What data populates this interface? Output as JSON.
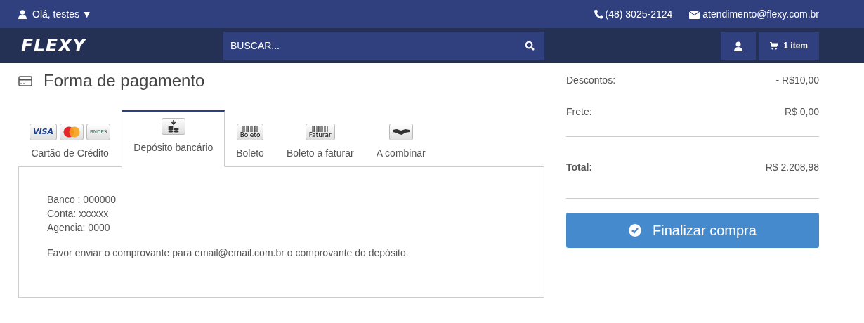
{
  "top_bar": {
    "greeting": "Olá, testes",
    "caret": "▼",
    "phone": "(48) 3025-2124",
    "email": "atendimento@flexy.com.br"
  },
  "header": {
    "logo": "FLEXY",
    "search": {
      "placeholder": "BUSCAR..."
    },
    "cart": "1 item"
  },
  "payment": {
    "title": "Forma de pagamento",
    "tabs": [
      {
        "label": "Cartão de Crédito",
        "kind": "cards",
        "badges": [
          "VISA",
          "BNDES"
        ],
        "selected": false
      },
      {
        "label": "Depósito bancário",
        "kind": "deposit",
        "selected": true
      },
      {
        "label": "Boleto",
        "kind": "barcode",
        "badges": [
          "Boleto"
        ],
        "selected": false
      },
      {
        "label": "Boleto a faturar",
        "kind": "barcode",
        "badges": [
          "Faturar"
        ],
        "selected": false
      },
      {
        "label": "A combinar",
        "kind": "handshake",
        "selected": false
      }
    ],
    "details": [
      "Banco : 000000",
      "Conta: xxxxxx",
      "Agencia: 0000"
    ],
    "note": "Favor enviar o comprovante para email@email.com.br o comprovante do depósito."
  },
  "summary": {
    "rows": [
      {
        "label": "Descontos:",
        "value": "- R$10,00",
        "bold": false
      },
      {
        "label": "Frete:",
        "value": "R$ 0,00",
        "bold": false
      },
      {
        "label": "Total:",
        "value": "R$ 2.208,98",
        "bold": true
      }
    ],
    "checkout_button": "Finalizar compra"
  }
}
